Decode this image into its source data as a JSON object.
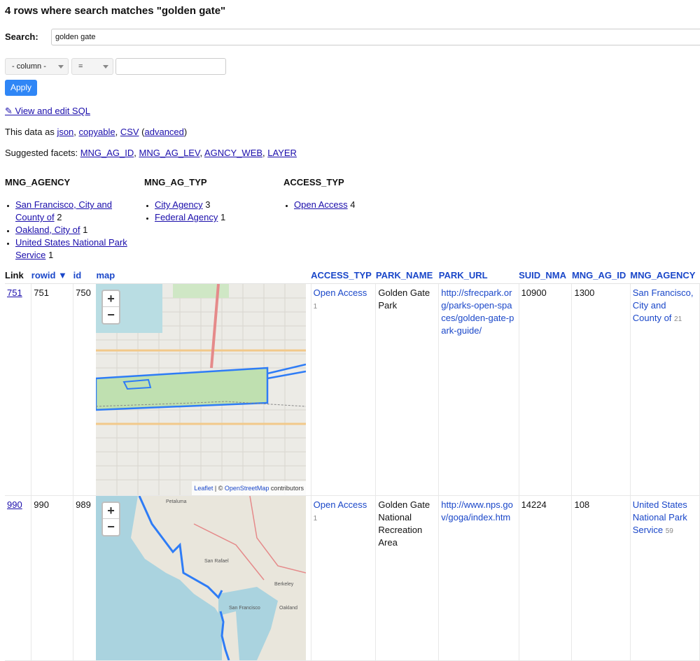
{
  "heading": "4 rows where search matches \"golden gate\"",
  "search": {
    "label": "Search:",
    "value": "golden gate"
  },
  "filter": {
    "column_label": "- column -",
    "op_label": "=",
    "apply_label": "Apply"
  },
  "sql_link": "✎ View and edit SQL",
  "export": {
    "prefix": "This data as ",
    "json": "json",
    "copyable": "copyable",
    "csv": "CSV",
    "advanced": "advanced",
    "sep": ", ",
    "open": " (",
    "close": ")"
  },
  "suggested": {
    "prefix": "Suggested facets: ",
    "items": [
      "MNG_AG_ID",
      "MNG_AG_LEV",
      "AGNCY_WEB",
      "LAYER"
    ]
  },
  "facets": [
    {
      "title": "MNG_AGENCY",
      "items": [
        {
          "label": "San Francisco, City and County of",
          "count": "2"
        },
        {
          "label": "Oakland, City of",
          "count": "1"
        },
        {
          "label": "United States National Park Service",
          "count": "1"
        }
      ]
    },
    {
      "title": "MNG_AG_TYP",
      "items": [
        {
          "label": "City Agency",
          "count": "3"
        },
        {
          "label": "Federal Agency",
          "count": "1"
        }
      ]
    },
    {
      "title": "ACCESS_TYP",
      "items": [
        {
          "label": "Open Access",
          "count": "4"
        }
      ]
    }
  ],
  "table": {
    "headers": [
      "Link",
      "rowid ▼",
      "id",
      "map",
      "ACCESS_TYP",
      "PARK_NAME",
      "PARK_URL",
      "SUID_NMA",
      "MNG_AG_ID",
      "MNG_AGENCY"
    ],
    "rows": [
      {
        "link": "751",
        "rowid": "751",
        "id": "750",
        "access": "Open Access",
        "access_count": "1",
        "park_name": "Golden Gate Park",
        "park_url": "http://sfrecpark.org/parks-open-spaces/golden-gate-park-guide/",
        "suid": "10900",
        "ag_id": "1300",
        "agency": "San Francisco, City and County of",
        "agency_count": "21"
      },
      {
        "link": "990",
        "rowid": "990",
        "id": "989",
        "access": "Open Access",
        "access_count": "1",
        "park_name": "Golden Gate National Recreation Area",
        "park_url": "http://www.nps.gov/goga/index.htm",
        "suid": "14224",
        "ag_id": "108",
        "agency": "United States National Park Service",
        "agency_count": "59"
      }
    ]
  },
  "map": {
    "zoom_in": "+",
    "zoom_out": "−",
    "attribution_leaflet": "Leaflet",
    "attribution_rest": " | © ",
    "attribution_osm": "OpenStreetMap",
    "attribution_tail": " contributors"
  },
  "map2_labels": [
    "Petaluma",
    "San Rafael",
    "San Francisco",
    "Berkeley",
    "Oakland"
  ]
}
